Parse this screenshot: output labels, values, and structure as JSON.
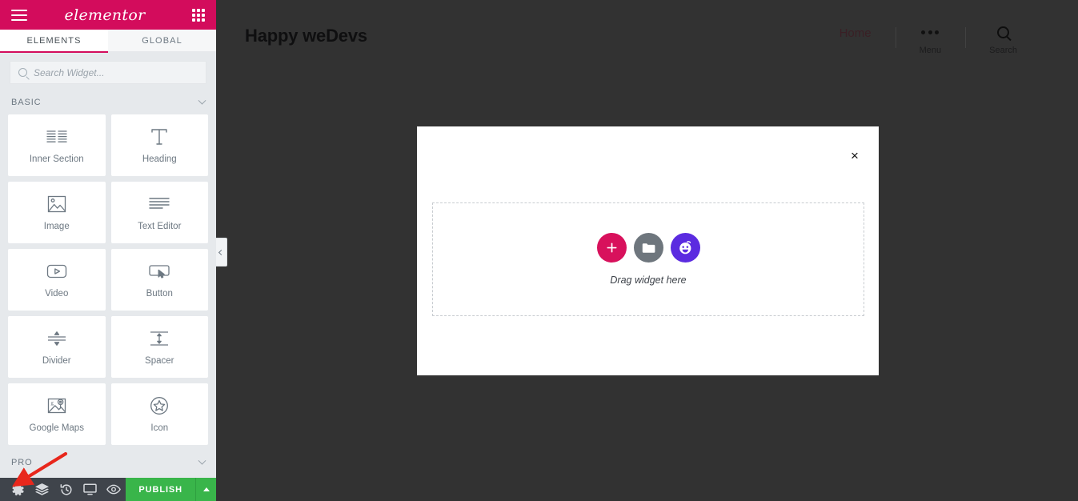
{
  "panel": {
    "brand": "elementor",
    "menu_icon": "hamburger-icon",
    "apps_icon": "grid-icon",
    "tabs": [
      {
        "label": "ELEMENTS",
        "active": true
      },
      {
        "label": "GLOBAL",
        "active": false
      }
    ],
    "search": {
      "placeholder": "Search Widget...",
      "value": "",
      "icon": "search-icon"
    },
    "sections": [
      {
        "title": "BASIC",
        "collapsed": false,
        "widgets": [
          {
            "label": "Inner Section",
            "icon": "inner-section-icon"
          },
          {
            "label": "Heading",
            "icon": "heading-icon"
          },
          {
            "label": "Image",
            "icon": "image-icon"
          },
          {
            "label": "Text Editor",
            "icon": "text-editor-icon"
          },
          {
            "label": "Video",
            "icon": "video-icon"
          },
          {
            "label": "Button",
            "icon": "button-icon"
          },
          {
            "label": "Divider",
            "icon": "divider-icon"
          },
          {
            "label": "Spacer",
            "icon": "spacer-icon"
          },
          {
            "label": "Google Maps",
            "icon": "google-maps-icon"
          },
          {
            "label": "Icon",
            "icon": "star-icon"
          }
        ]
      },
      {
        "title": "PRO",
        "collapsed": true,
        "widgets": []
      }
    ],
    "collapse_handle_icon": "chevron-left-icon",
    "footer": {
      "buttons": [
        {
          "name": "settings",
          "icon": "gear-icon"
        },
        {
          "name": "navigator",
          "icon": "layers-icon"
        },
        {
          "name": "history",
          "icon": "history-icon"
        },
        {
          "name": "responsive-mode",
          "icon": "monitor-icon"
        },
        {
          "name": "preview",
          "icon": "eye-icon"
        }
      ],
      "publish_label": "PUBLISH",
      "publish_caret_icon": "caret-up-icon",
      "publish_color": "#39b54a"
    },
    "accent_color": "#d30c5c"
  },
  "canvas": {
    "background": "#323232",
    "site_title": "Happy weDevs",
    "nav": {
      "home_label": "Home",
      "home_color": "#3a1f25",
      "menu_label": "Menu",
      "menu_icon": "three-dots-icon",
      "search_label": "Search",
      "search_icon": "search-icon"
    }
  },
  "modal": {
    "close_icon": "close-icon",
    "close_label": "×",
    "dropzone": {
      "hint": "Drag widget here",
      "buttons": [
        {
          "name": "add-section",
          "icon": "plus-icon",
          "color": "#d8115c"
        },
        {
          "name": "add-template",
          "icon": "folder-icon",
          "color": "#6e767d"
        },
        {
          "name": "happy-addons",
          "icon": "happy-face-icon",
          "color": "#5b2be0"
        }
      ]
    }
  },
  "annotation": {
    "arrow_color": "#e8271c",
    "points_to": "settings-button"
  }
}
